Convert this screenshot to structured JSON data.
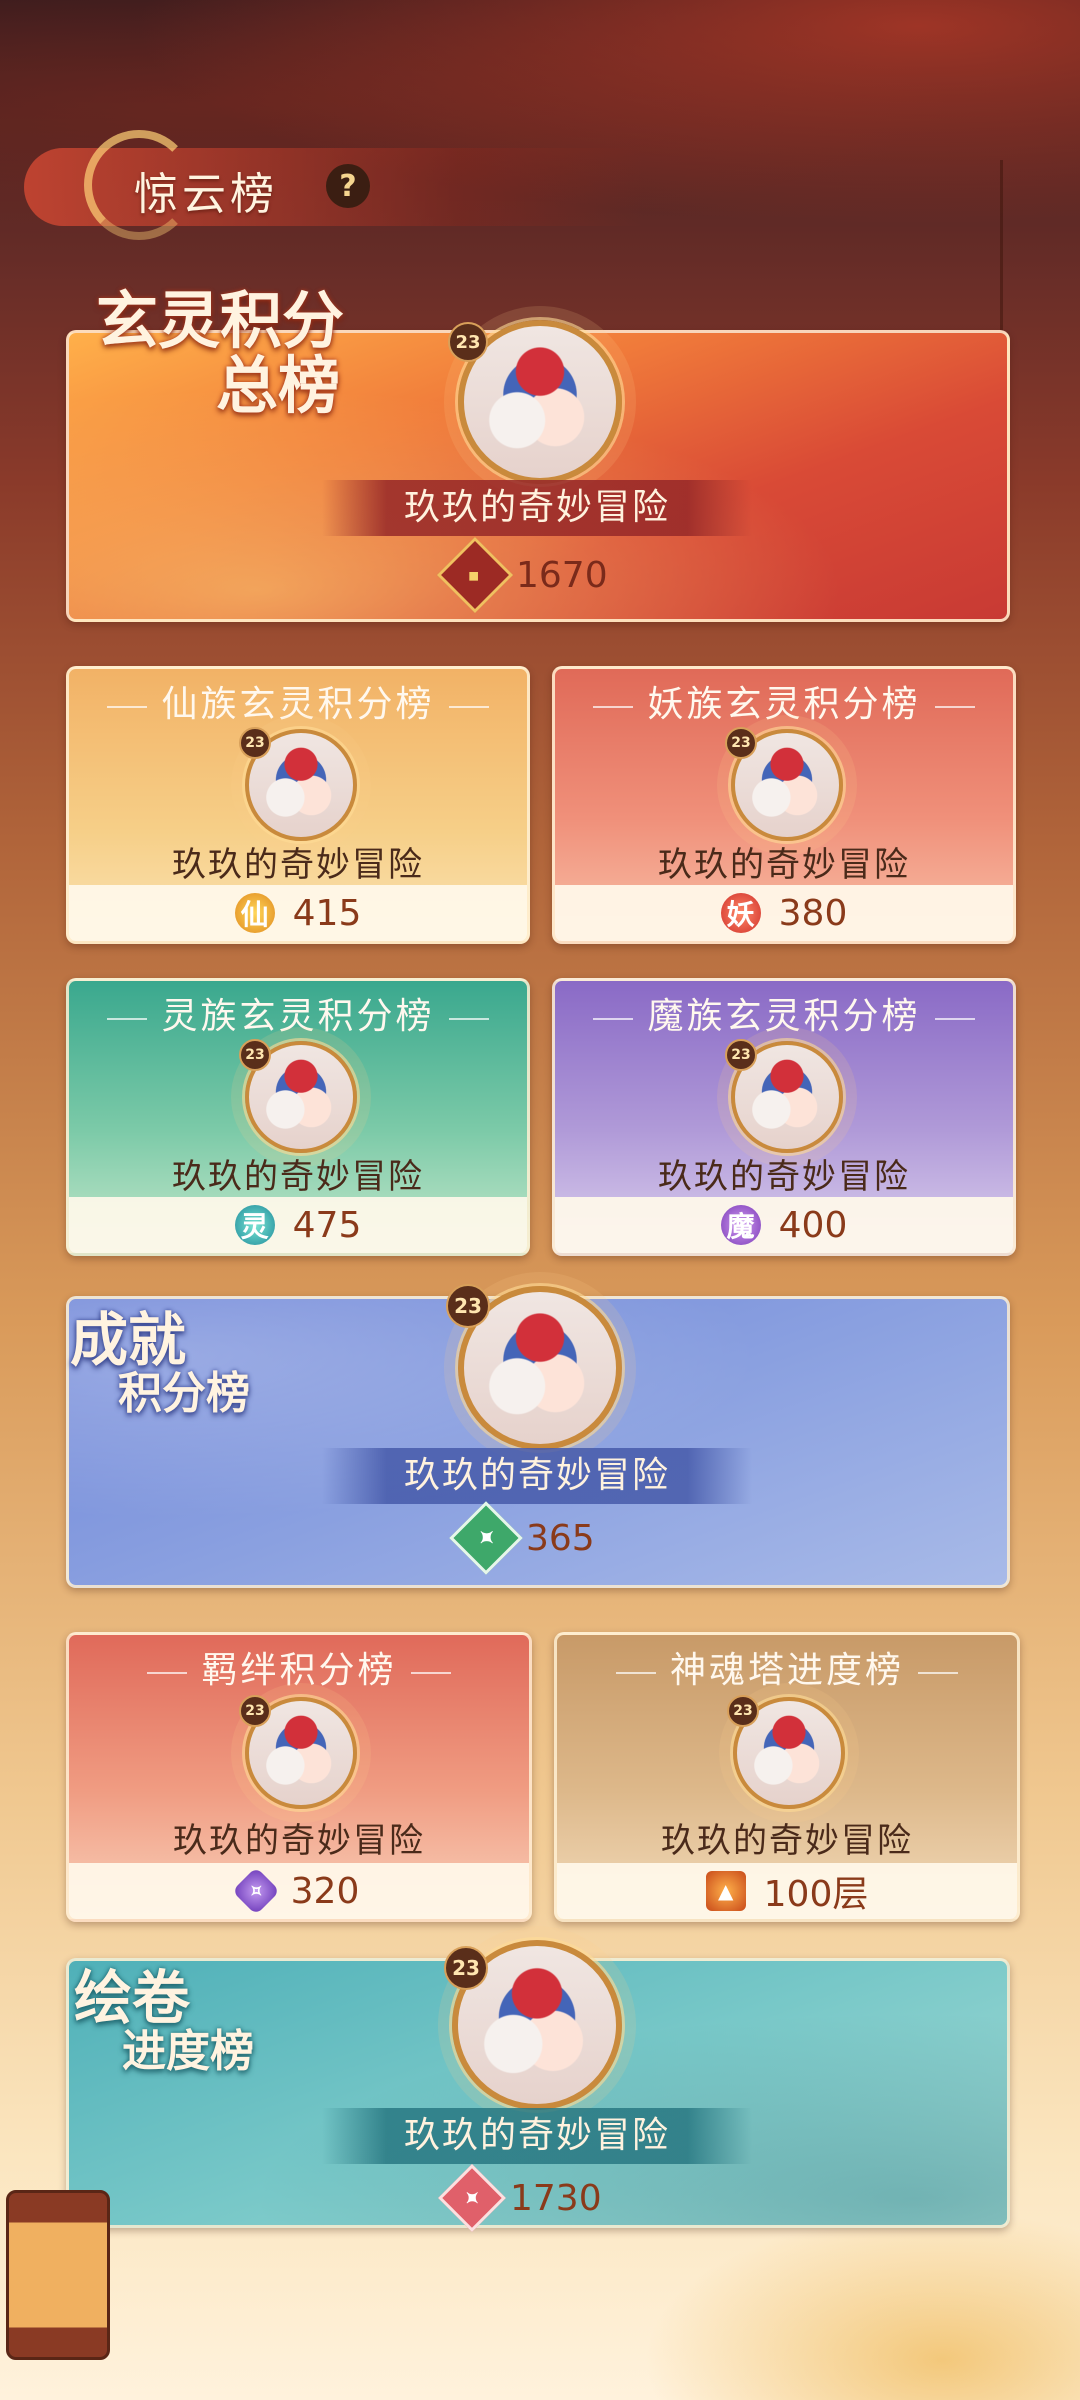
{
  "header": {
    "title": "惊云榜",
    "help_symbol": "?"
  },
  "player": {
    "name": "玖玖的奇妙冒险",
    "level": "23"
  },
  "main_board": {
    "title_line1": "玄灵积分",
    "title_line2": "总榜",
    "score": "1670"
  },
  "faction_boards": [
    {
      "title": "仙族玄灵积分榜",
      "icon_char": "仙",
      "score": "415",
      "color": "#e39a3c"
    },
    {
      "title": "妖族玄灵积分榜",
      "icon_char": "妖",
      "score": "380",
      "color": "#e0543c"
    },
    {
      "title": "灵族玄灵积分榜",
      "icon_char": "灵",
      "score": "475",
      "color": "#3aa89a"
    },
    {
      "title": "魔族玄灵积分榜",
      "icon_char": "魔",
      "score": "400",
      "color": "#8c5ac8"
    }
  ],
  "achievement_board": {
    "title_line1": "成就",
    "title_line2": "积分榜",
    "score": "365"
  },
  "bond_board": {
    "title": "羁绊积分榜",
    "score": "320"
  },
  "tower_board": {
    "title": "神魂塔进度榜",
    "score": "100层"
  },
  "scroll_board": {
    "title_line1": "绘卷",
    "title_line2": "进度榜",
    "score": "1730"
  }
}
